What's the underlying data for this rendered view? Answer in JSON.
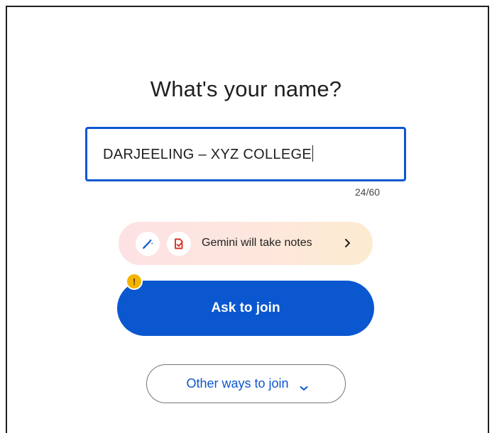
{
  "prompt": {
    "title": "What's your name?"
  },
  "name_input": {
    "value": "DARJEELING – XYZ COLLEGE",
    "counter": "24/60"
  },
  "gemini_chip": {
    "label": "Gemini will take notes",
    "icons": [
      "pen-sparkle-icon",
      "document-notes-icon",
      "chevron-right-icon"
    ]
  },
  "warning_badge": {
    "symbol": "!",
    "icon": "warning-icon"
  },
  "actions": {
    "ask_to_join_label": "Ask to join",
    "other_ways_label": "Other ways to join",
    "other_ways_icon": "chevron-down-icon"
  },
  "colors": {
    "primary": "#0b57d0",
    "warning": "#f4b400",
    "notes_icon": "#d93025",
    "text": "#1f1f1f"
  }
}
